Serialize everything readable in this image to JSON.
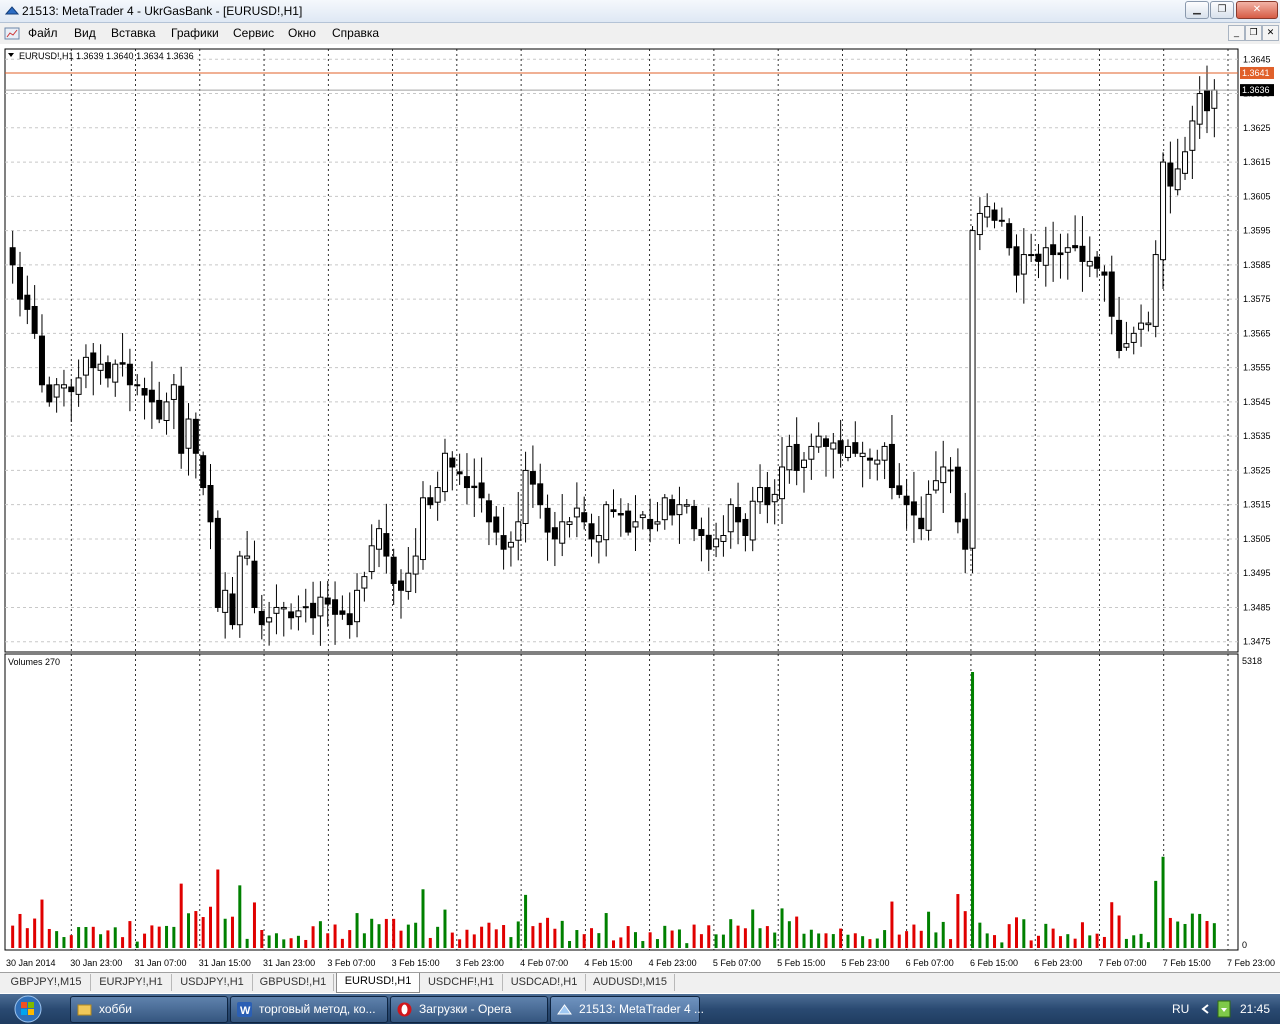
{
  "window": {
    "title": "21513: MetaTrader 4 - UkrGasBank - [EURUSD!,H1]",
    "buttons": [
      "minimize",
      "restore",
      "close"
    ]
  },
  "menu": [
    "Файл",
    "Вид",
    "Вставка",
    "Графики",
    "Сервис",
    "Окно",
    "Справка"
  ],
  "chart_data": {
    "type": "candlestick",
    "title": "EURUSD!,H1  1.3639 1.3640 1.3634 1.3636",
    "symbol_label": "EURUSD!,H1",
    "ohlc_label": "1.3639 1.3640 1.3634 1.3636",
    "bid_price": "1.3636",
    "ask_price": "1.3641",
    "ask_line_color": "#e0602a",
    "price_ticks": [
      "1.3645",
      "1.3635",
      "1.3625",
      "1.3615",
      "1.3605",
      "1.3595",
      "1.3585",
      "1.3575",
      "1.3565",
      "1.3555",
      "1.3545",
      "1.3535",
      "1.3525",
      "1.3515",
      "1.3505",
      "1.3495",
      "1.3485",
      "1.3475"
    ],
    "ylim": [
      1.3472,
      1.3648
    ],
    "time_labels": [
      "30 Jan 2014",
      "30 Jan 23:00",
      "31 Jan 07:00",
      "31 Jan 15:00",
      "31 Jan 23:00",
      "3 Feb 07:00",
      "3 Feb 15:00",
      "3 Feb 23:00",
      "4 Feb 07:00",
      "4 Feb 15:00",
      "4 Feb 23:00",
      "5 Feb 07:00",
      "5 Feb 15:00",
      "5 Feb 23:00",
      "6 Feb 07:00",
      "6 Feb 15:00",
      "6 Feb 23:00",
      "7 Feb 07:00",
      "7 Feb 15:00",
      "7 Feb 23:00"
    ],
    "close_prices": [
      1.3585,
      1.3575,
      1.3572,
      1.3565,
      1.355,
      1.3545,
      1.355,
      1.355,
      1.3548,
      1.3552,
      1.3558,
      1.3555,
      1.3556,
      1.3552,
      1.3556,
      1.3556,
      1.355,
      1.355,
      1.3547,
      1.3545,
      1.354,
      1.3545,
      1.355,
      1.353,
      1.354,
      1.353,
      1.352,
      1.351,
      1.3485,
      1.349,
      1.348,
      1.35,
      1.35,
      1.3485,
      1.348,
      1.3482,
      1.3485,
      1.3485,
      1.3482,
      1.3484,
      1.3485,
      1.3482,
      1.3488,
      1.3486,
      1.3483,
      1.3483,
      1.348,
      1.349,
      1.3494,
      1.3503,
      1.3508,
      1.35,
      1.3492,
      1.349,
      1.3495,
      1.35,
      1.3517,
      1.3515,
      1.352,
      1.353,
      1.3526,
      1.3524,
      1.352,
      1.352,
      1.3517,
      1.351,
      1.3507,
      1.3502,
      1.3504,
      1.351,
      1.3525,
      1.3521,
      1.3515,
      1.3507,
      1.3505,
      1.351,
      1.351,
      1.3514,
      1.351,
      1.3505,
      1.3506,
      1.3515,
      1.3513,
      1.3512,
      1.3507,
      1.351,
      1.3512,
      1.3508,
      1.351,
      1.3517,
      1.3512,
      1.3515,
      1.3515,
      1.3508,
      1.3506,
      1.3502,
      1.3505,
      1.3506,
      1.3515,
      1.351,
      1.3506,
      1.3516,
      1.352,
      1.3515,
      1.3518,
      1.3526,
      1.3532,
      1.3525,
      1.3528,
      1.3532,
      1.3535,
      1.3532,
      1.3533,
      1.353,
      1.3532,
      1.353,
      1.353,
      1.3528,
      1.3528,
      1.3532,
      1.352,
      1.3518,
      1.3515,
      1.3512,
      1.3508,
      1.3518,
      1.3522,
      1.3526,
      1.3525,
      1.351,
      1.3502,
      1.3595,
      1.36,
      1.3602,
      1.3598,
      1.3598,
      1.359,
      1.3582,
      1.3588,
      1.3588,
      1.3586,
      1.359,
      1.3588,
      1.3588,
      1.359,
      1.359,
      1.3586,
      1.3586,
      1.3584,
      1.3582,
      1.357,
      1.356,
      1.3562,
      1.3565,
      1.3568,
      1.3568,
      1.3588,
      1.3615,
      1.3608,
      1.3613,
      1.3618,
      1.3627,
      1.3635,
      1.363,
      1.3636
    ],
    "volume_label": "Volumes 270",
    "volume_max_label": "5318",
    "volume_zero_label": "0",
    "volume_colors": {
      "up": "#008000",
      "down": "#e00000"
    }
  },
  "tabs": [
    "GBPJPY!,M15",
    "EURJPY!,H1",
    "USDJPY!,H1",
    "GBPUSD!,H1",
    "EURUSD!,H1",
    "USDCHF!,H1",
    "USDCAD!,H1",
    "AUDUSD!,M15"
  ],
  "active_tab": "EURUSD!,H1",
  "taskbar": {
    "items": [
      "хобби",
      "торговый метод, ко...",
      "Загрузки - Opera",
      "21513: MetaTrader 4 ..."
    ],
    "language": "RU",
    "clock": "21:45"
  }
}
